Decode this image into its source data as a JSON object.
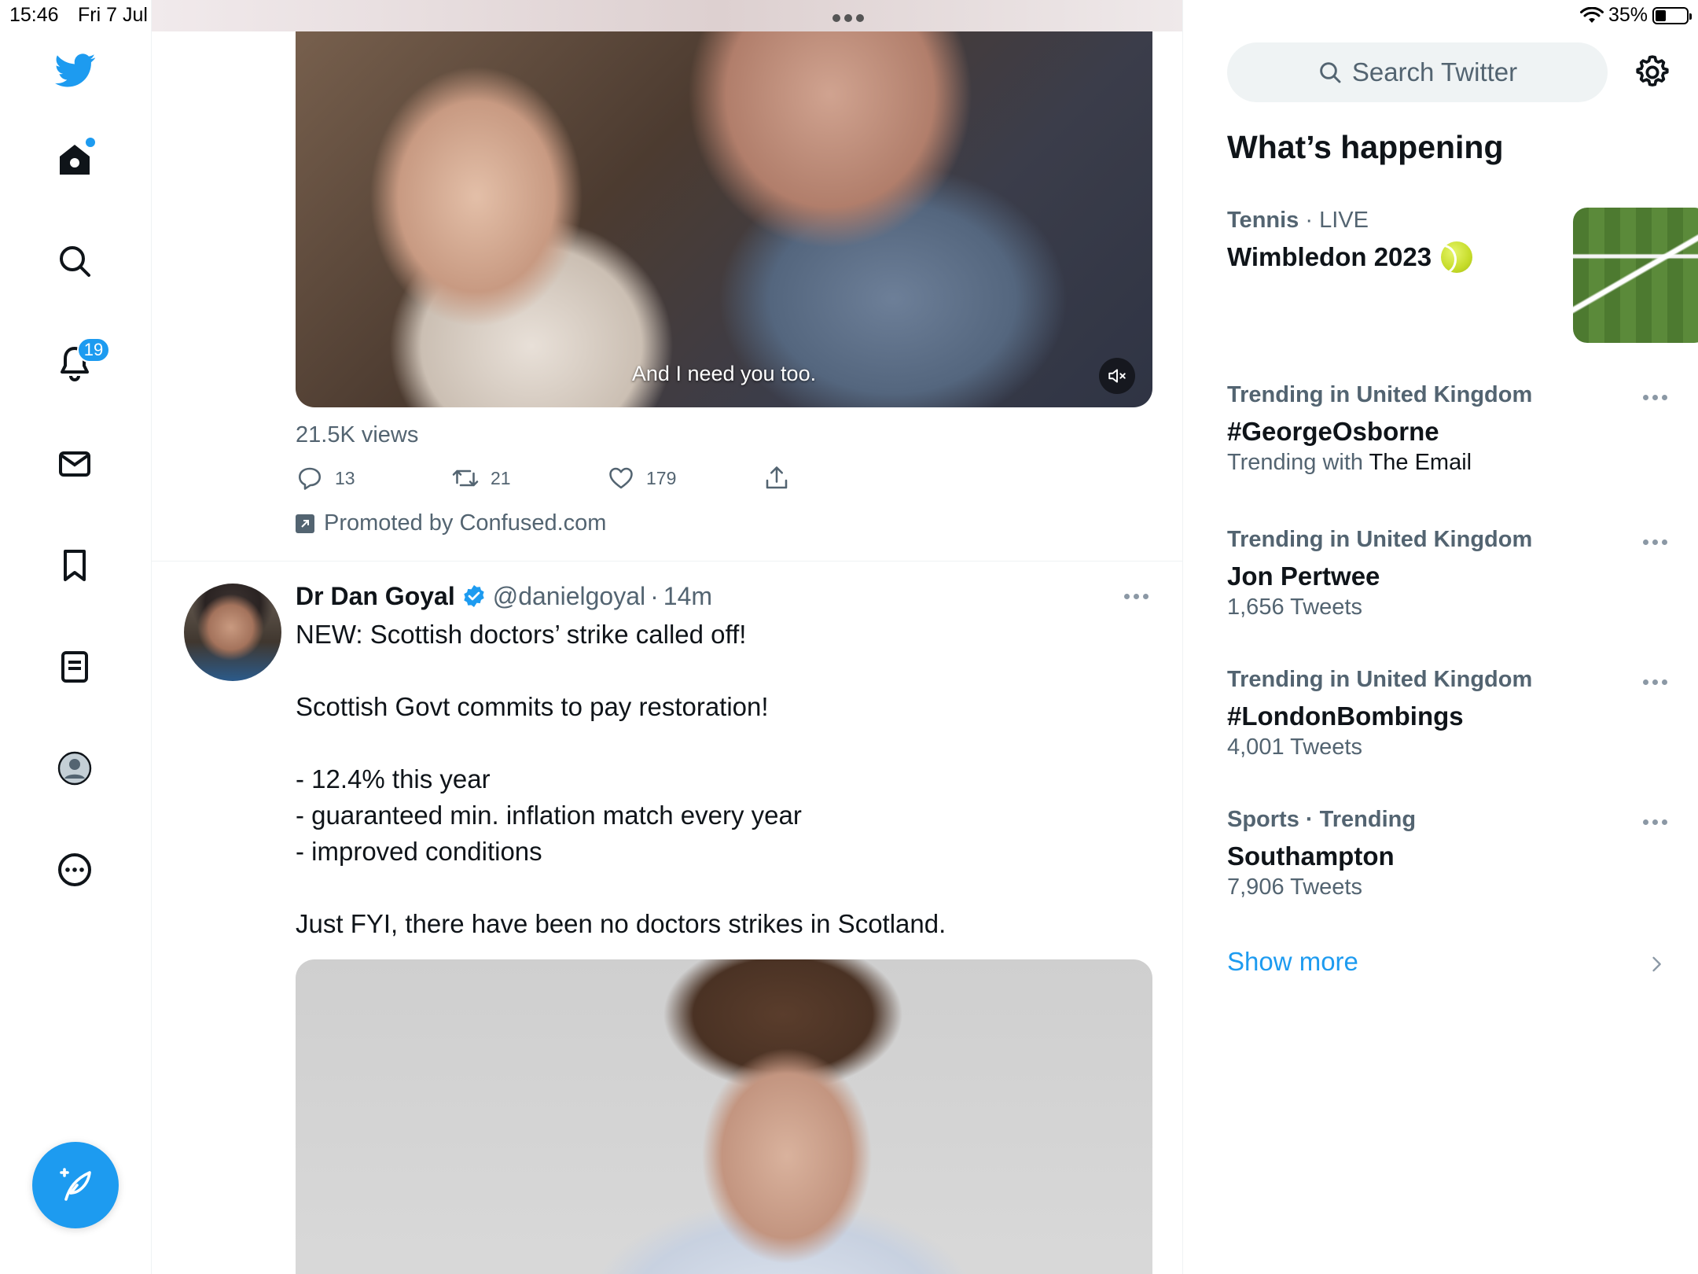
{
  "status_bar": {
    "time": "15:46",
    "date": "Fri 7 Jul",
    "battery_percent_label": "35%",
    "battery_level": 0.35
  },
  "left_nav": {
    "items": [
      {
        "id": "logo",
        "icon": "twitter-bird-icon"
      },
      {
        "id": "home",
        "icon": "home-icon",
        "has_dot": true
      },
      {
        "id": "explore",
        "icon": "search-icon"
      },
      {
        "id": "notifications",
        "icon": "bell-icon",
        "badge": "19"
      },
      {
        "id": "messages",
        "icon": "mail-icon"
      },
      {
        "id": "bookmarks",
        "icon": "bookmark-icon"
      },
      {
        "id": "lists",
        "icon": "list-icon"
      },
      {
        "id": "profile",
        "icon": "profile-icon"
      },
      {
        "id": "more",
        "icon": "more-circle-icon"
      }
    ],
    "compose_icon": "compose-tweet-icon"
  },
  "timeline": {
    "promoted_tweet": {
      "video_caption": "And I need you too.",
      "views": "21.5K views",
      "replies": "13",
      "retweets": "21",
      "likes": "179",
      "promoted_label": "Promoted by Confused.com"
    },
    "tweet": {
      "author_name": "Dr Dan Goyal",
      "handle": "@danielgoyal",
      "separator": "·",
      "time": "14m",
      "lines": [
        "NEW: Scottish doctors’ strike called off!",
        "",
        "Scottish Govt commits to pay restoration!",
        "",
        "- 12.4% this year",
        "- guaranteed min. inflation match every year",
        "- improved conditions",
        "",
        "Just FYI, there have been no doctors strikes in Scotland."
      ]
    }
  },
  "sidebar": {
    "search_placeholder": "Search Twitter",
    "section_title": "What’s happening",
    "trends": [
      {
        "category": "Tennis",
        "extra": " · LIVE",
        "title": "Wimbledon 2023",
        "sub_prefix": "",
        "sub_value": "",
        "has_thumb": true
      },
      {
        "category": "Trending in United Kingdom",
        "extra": "",
        "title": "#GeorgeOsborne",
        "sub_prefix": "Trending with ",
        "sub_value": "The Email"
      },
      {
        "category": "Trending in United Kingdom",
        "extra": "",
        "title": "Jon Pertwee",
        "sub_prefix": "1,656 Tweets",
        "sub_value": ""
      },
      {
        "category": "Trending in United Kingdom",
        "extra": "",
        "title": "#LondonBombings",
        "sub_prefix": "4,001 Tweets",
        "sub_value": ""
      },
      {
        "category": "Sports · Trending",
        "extra": "",
        "title": "Southampton",
        "sub_prefix": "7,906 Tweets",
        "sub_value": ""
      }
    ],
    "show_more": "Show more"
  },
  "colors": {
    "accent": "#1d9bf0",
    "text_primary": "#0f1419",
    "text_secondary": "#536471"
  }
}
